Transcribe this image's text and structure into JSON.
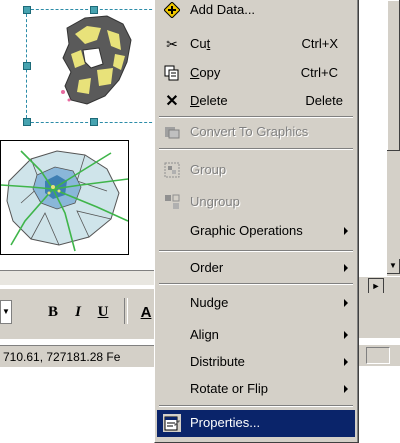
{
  "menu": {
    "items": [
      {
        "label": "Add Data...",
        "accel": "",
        "icon": "add-data-icon",
        "glyph": "✚",
        "enabled": true
      },
      {
        "label": "Cut",
        "mnemonic": "t",
        "accel": "Ctrl+X",
        "icon": "scissors-icon",
        "glyph": "✂",
        "enabled": true
      },
      {
        "label": "Copy",
        "mnemonic": "C",
        "accel": "Ctrl+C",
        "icon": "copy-icon",
        "glyph": "⎘",
        "enabled": true
      },
      {
        "label": "Delete",
        "mnemonic": "D",
        "accel": "Delete",
        "icon": "delete-x-icon",
        "glyph": "✕",
        "enabled": true
      },
      {
        "label": "Convert To Graphics",
        "accel": "",
        "icon": "convert-icon",
        "glyph": "",
        "enabled": false
      },
      {
        "label": "Group",
        "accel": "",
        "icon": "group-icon",
        "glyph": "",
        "enabled": false
      },
      {
        "label": "Ungroup",
        "accel": "",
        "icon": "ungroup-icon",
        "glyph": "",
        "enabled": false
      },
      {
        "label": "Graphic Operations",
        "accel": "",
        "submenu": true,
        "enabled": true
      },
      {
        "label": "Order",
        "accel": "",
        "submenu": true,
        "enabled": true
      },
      {
        "label": "Nudge",
        "accel": "",
        "submenu": true,
        "enabled": true
      },
      {
        "label": "Align",
        "accel": "",
        "submenu": true,
        "enabled": true
      },
      {
        "label": "Distribute",
        "accel": "",
        "submenu": true,
        "enabled": true
      },
      {
        "label": "Rotate or Flip",
        "accel": "",
        "submenu": true,
        "enabled": true
      },
      {
        "label": "Properties...",
        "accel": "",
        "icon": "properties-icon",
        "glyph": "",
        "enabled": true,
        "selected": true
      }
    ]
  },
  "toolbar": {
    "bold": "B",
    "italic": "I",
    "underline": "U",
    "font_color": "A"
  },
  "status": {
    "coordinates": "710.61, 727181.28 Fe"
  },
  "scroll": {
    "down_arrow": "▼",
    "right_arrow": "►",
    "dropdown": "▼"
  },
  "colors": {
    "menu_bg": "#d4d0c8",
    "highlight": "#0a246a",
    "selection_dash": "#2c8ca8",
    "map_yellow": "#e8e27a",
    "map_dark": "#5a5a5a",
    "map_light_blue": "#cfe4ea",
    "map_road_green": "#3fb54a"
  }
}
